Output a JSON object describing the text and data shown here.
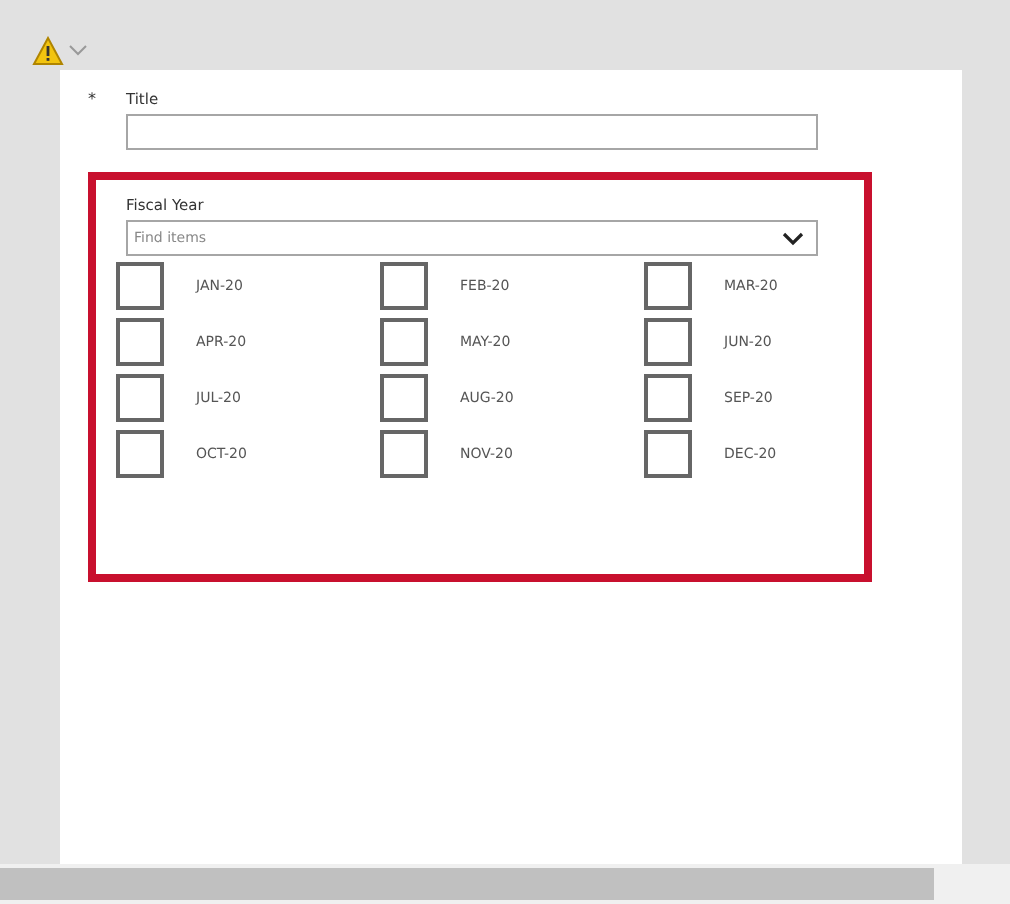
{
  "required_mark": "*",
  "title_field": {
    "label": "Title"
  },
  "fiscal_year": {
    "label": "Fiscal Year",
    "placeholder": "Find items",
    "highlighted": true,
    "options": [
      {
        "label": "JAN-20",
        "checked": false
      },
      {
        "label": "FEB-20",
        "checked": false
      },
      {
        "label": "MAR-20",
        "checked": false
      },
      {
        "label": "APR-20",
        "checked": false
      },
      {
        "label": "MAY-20",
        "checked": false
      },
      {
        "label": "JUN-20",
        "checked": false
      },
      {
        "label": "JUL-20",
        "checked": false
      },
      {
        "label": "AUG-20",
        "checked": false
      },
      {
        "label": "SEP-20",
        "checked": false
      },
      {
        "label": "OCT-20",
        "checked": false
      },
      {
        "label": "NOV-20",
        "checked": false
      },
      {
        "label": "DEC-20",
        "checked": false
      }
    ]
  }
}
